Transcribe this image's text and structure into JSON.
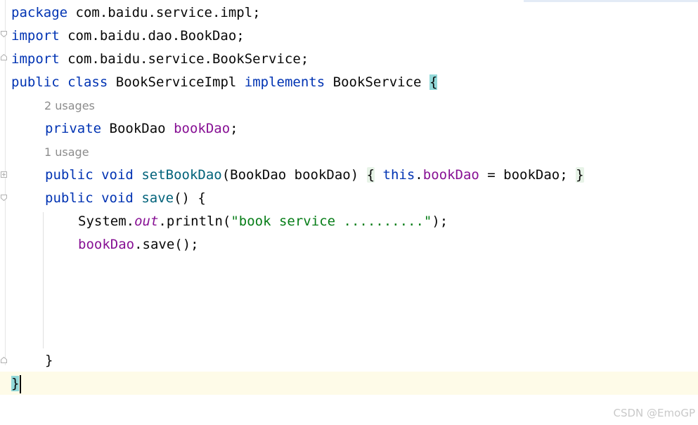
{
  "editor": {
    "language": "java",
    "lines": {
      "l1": {
        "kw": "package",
        "rest": " com.baidu.service.impl;"
      },
      "l2": {
        "kw": "import",
        "rest": " com.baidu.dao.BookDao;"
      },
      "l3": {
        "kw": "import",
        "rest": " com.baidu.service.BookService;"
      },
      "l4": {
        "kw1": "public",
        "kw2": "class",
        "name": "BookServiceImpl",
        "kw3": "implements",
        "iface": "BookService",
        "brace": "{"
      },
      "hint1": "2 usages",
      "l5": {
        "kw": "private",
        "type": "BookDao",
        "field": "bookDao",
        "end": ";"
      },
      "hint2": "1 usage",
      "l6": {
        "kw1": "public",
        "kw2": "void",
        "method": "setBookDao",
        "params": "(BookDao bookDao)",
        "ob": "{",
        "this": "this",
        "dot": ".",
        "field": "bookDao",
        "assign": " = bookDao;",
        "cb": "}"
      },
      "l7": {
        "kw1": "public",
        "kw2": "void",
        "method": "save",
        "rest": "() {"
      },
      "l8": {
        "cls": "System.",
        "static": "out",
        "call": ".println(",
        "str": "\"book service ..........\"",
        "end": ");"
      },
      "l9": {
        "field": "bookDao",
        "rest": ".save();"
      },
      "l10": "}",
      "l11": "}"
    }
  },
  "watermark": "CSDN @EmoGP"
}
